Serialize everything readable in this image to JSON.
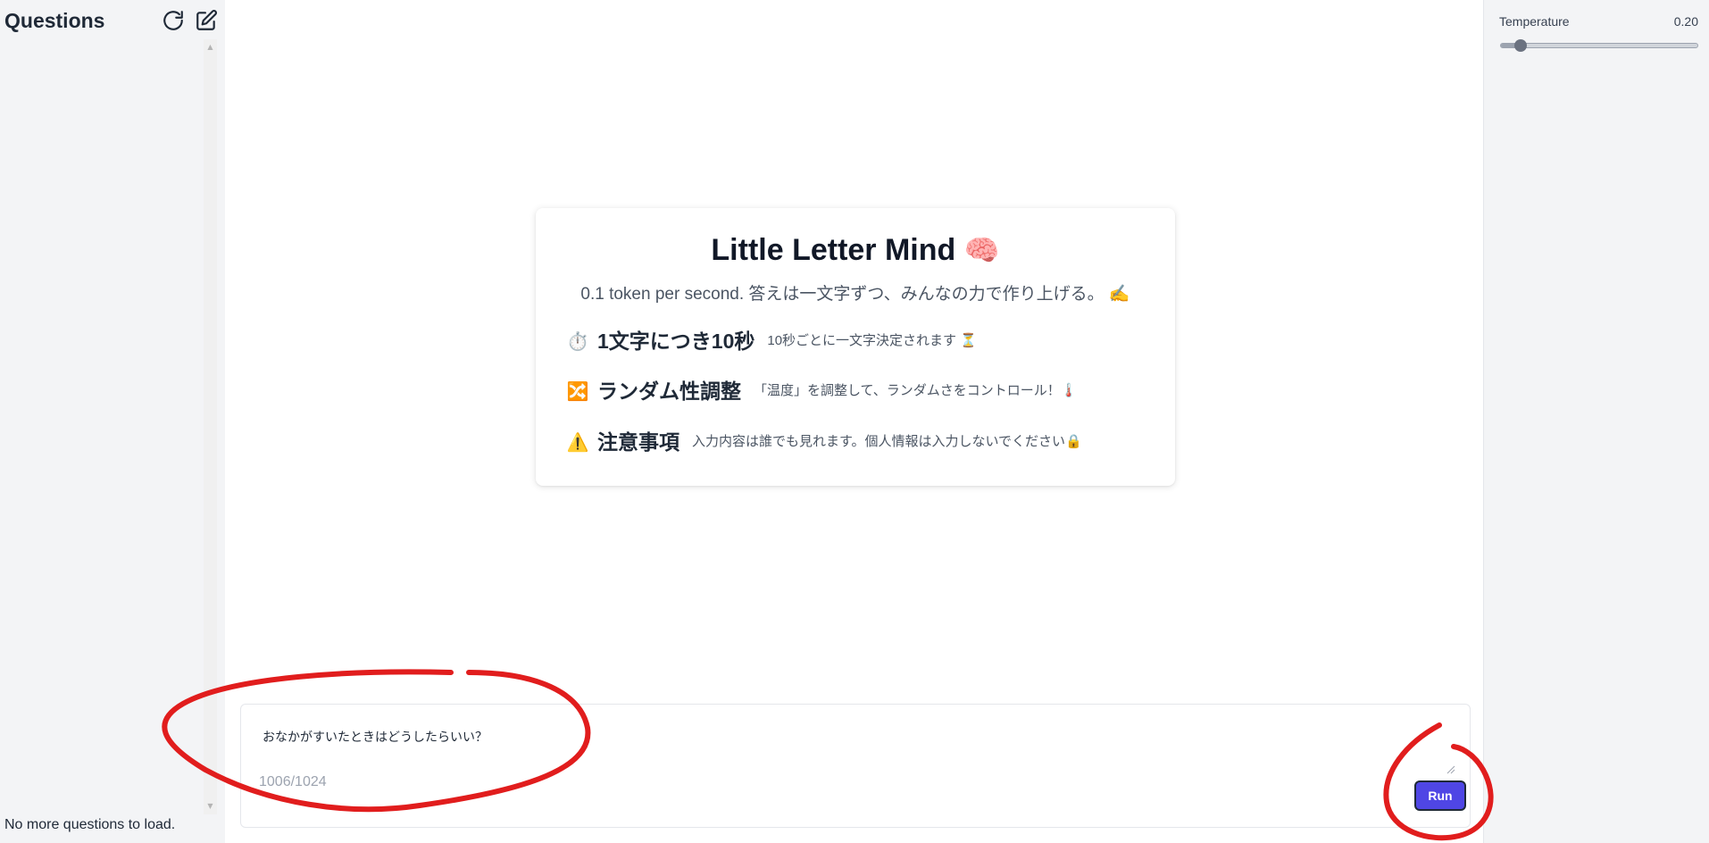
{
  "sidebar": {
    "title": "Questions",
    "refresh_icon": "refresh-icon",
    "new_icon": "edit-square-icon",
    "footer_text": "No more questions to load."
  },
  "settings": {
    "temperature_label": "Temperature",
    "temperature_value": "0.20",
    "temperature_fraction": 0.1
  },
  "card": {
    "title": "Little Letter Mind",
    "title_emoji": "🧠",
    "subtitle": "0.1 token per second. 答えは一文字ずつ、みんなの力で作り上げる。 ✍️",
    "features": [
      {
        "icon": "⏱️",
        "title": "1文字につき10秒",
        "description": "10秒ごとに一文字決定されます ⏳"
      },
      {
        "icon": "🔀",
        "title": "ランダム性調整",
        "description": "「温度」を調整して、ランダムさをコントロール！🌡️"
      },
      {
        "icon": "⚠️",
        "title": "注意事項",
        "description": "入力内容は誰でも見れます。個人情報は入力しないでください🔒"
      }
    ]
  },
  "input": {
    "value": "おなかがすいたときはどうしたらいい？",
    "char_count": "1006/1024",
    "run_label": "Run"
  },
  "colors": {
    "accent": "#4f46e5",
    "annotation": "#e11d1d",
    "panel_bg": "#f3f4f6"
  }
}
